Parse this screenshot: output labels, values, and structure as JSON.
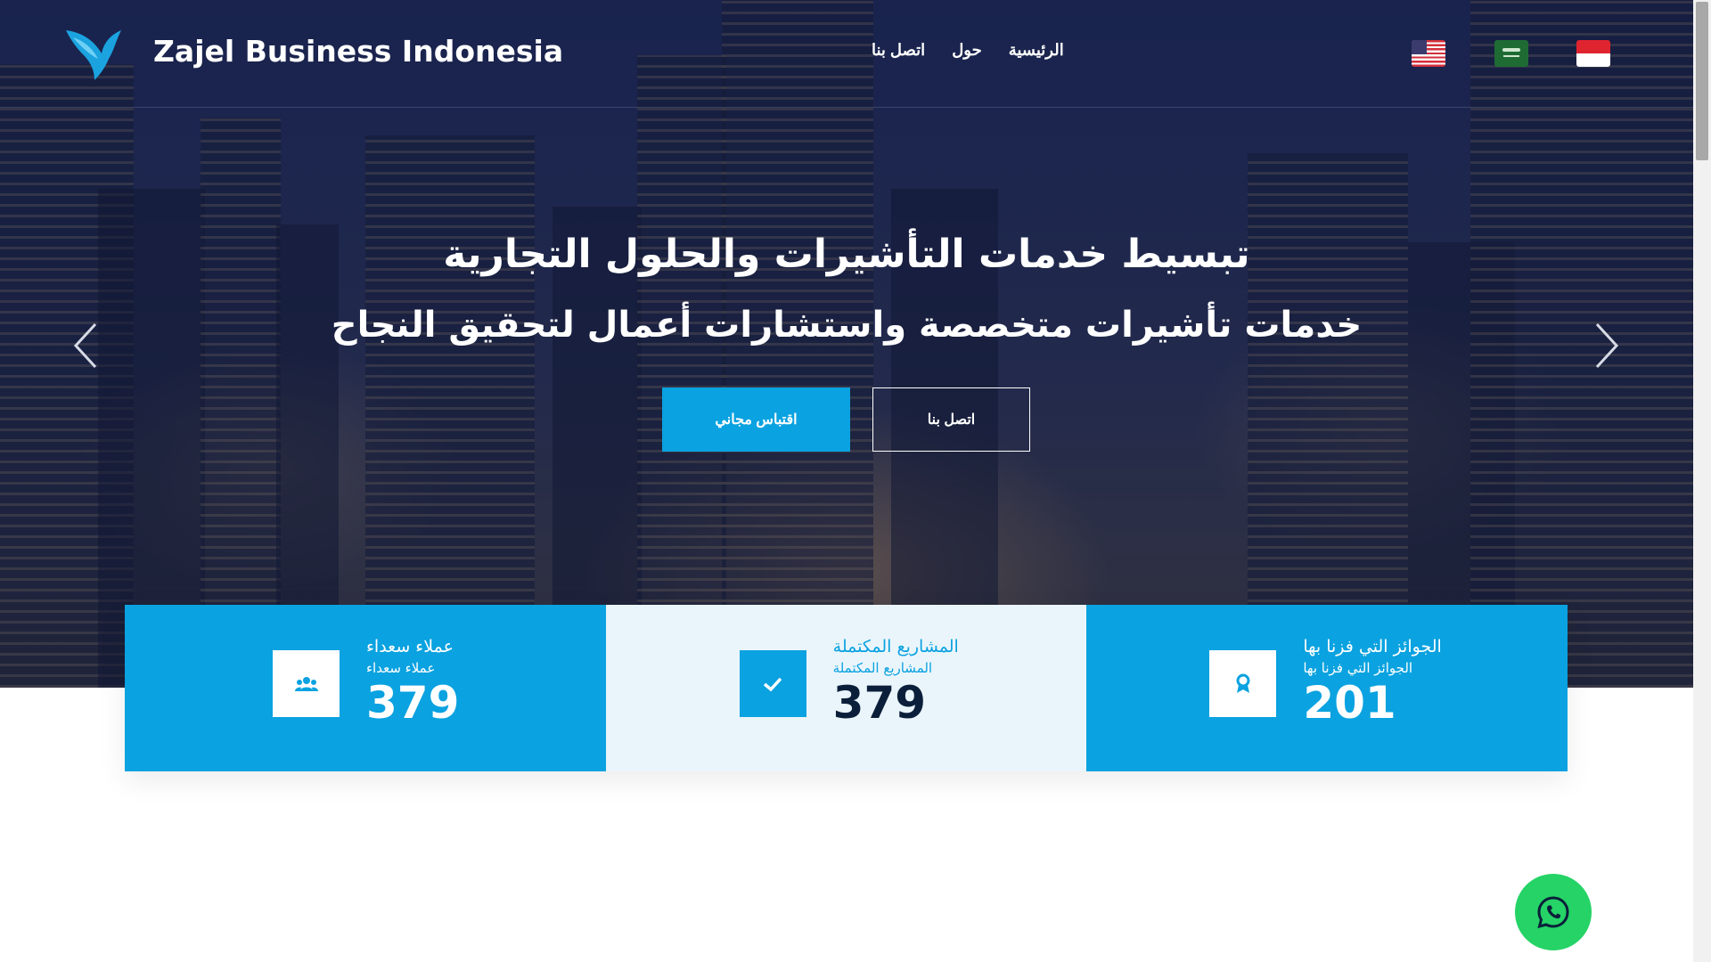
{
  "header": {
    "brand": "Zajel Business Indonesia",
    "nav": [
      {
        "label": "الرئيسية"
      },
      {
        "label": "حول"
      },
      {
        "label": "اتصل بنا"
      }
    ],
    "languages": [
      "us-flag-icon",
      "saudi-flag-icon",
      "indonesia-flag-icon"
    ]
  },
  "hero": {
    "title": "تبسيط خدمات التأشيرات والحلول التجارية",
    "subtitle": "خدمات تأشيرات متخصصة واستشارات أعمال لتحقيق النجاح",
    "buttons": {
      "quote": "اقتباس مجاني",
      "contact": "اتصل بنا"
    }
  },
  "stats": [
    {
      "label": "عملاء سعداء",
      "sub": "عملاء سعداء",
      "value": "379",
      "icon": "users-icon"
    },
    {
      "label": "المشاريع المكتملة",
      "sub": "المشاريع المكتملة",
      "value": "379",
      "icon": "check-icon"
    },
    {
      "label": "الجوائز التي فزنا بها",
      "sub": "الجوائز التي فزنا بها",
      "value": "201",
      "icon": "award-icon"
    }
  ],
  "colors": {
    "accent": "#0aa2e0",
    "whatsapp": "#25d366",
    "dark_text": "#0b1f3a"
  }
}
